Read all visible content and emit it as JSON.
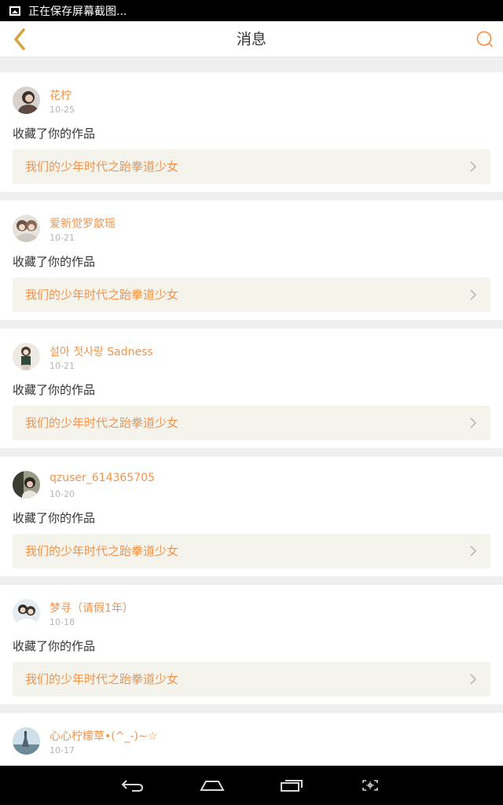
{
  "status_bar": {
    "text": "正在保存屏幕截图..."
  },
  "header": {
    "title": "消息"
  },
  "colors": {
    "accent": "#f0944e",
    "back_icon": "#d4a63a",
    "link_bg": "#f4f3ec"
  },
  "messages": [
    {
      "user": "花柠",
      "date": "10-25",
      "action": "收藏了你的作品",
      "work": "我们的少年时代之跆拳道少女"
    },
    {
      "user": "爱新觉罗歆瑶",
      "date": "10-21",
      "action": "收藏了你的作品",
      "work": "我们的少年时代之跆拳道少女"
    },
    {
      "user": "설아 첫사랑 Sadness",
      "date": "10-21",
      "action": "收藏了你的作品",
      "work": "我们的少年时代之跆拳道少女"
    },
    {
      "user": "qzuser_614365705",
      "date": "10-20",
      "action": "收藏了你的作品",
      "work": "我们的少年时代之跆拳道少女"
    },
    {
      "user": "梦寻（请假1年）",
      "date": "10-18",
      "action": "收藏了你的作品",
      "work": "我们的少年时代之跆拳道少女"
    },
    {
      "user": "心心柠檬草•(^_-)~☆",
      "date": "10-17",
      "action": "",
      "work": ""
    }
  ]
}
